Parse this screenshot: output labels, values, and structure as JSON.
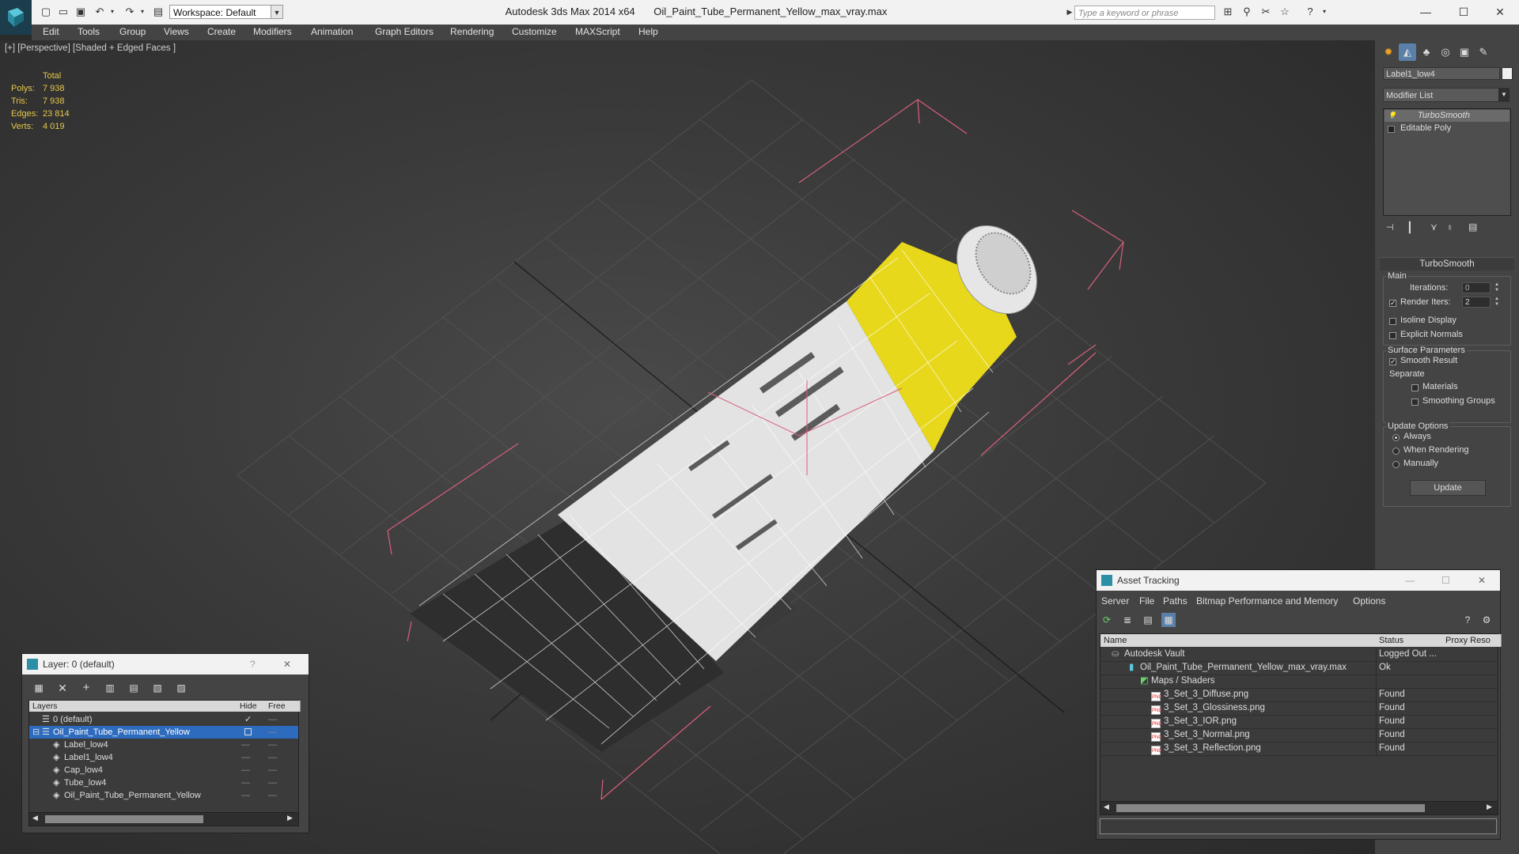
{
  "window": {
    "app_title": "Autodesk 3ds Max  2014 x64",
    "file_title": "Oil_Paint_Tube_Permanent_Yellow_max_vray.max",
    "workspace": "Workspace: Default",
    "search_placeholder": "Type a keyword or phrase"
  },
  "menu": [
    "Edit",
    "Tools",
    "Group",
    "Views",
    "Create",
    "Modifiers",
    "Animation",
    "Graph Editors",
    "Rendering",
    "Customize",
    "MAXScript",
    "Help"
  ],
  "viewport": {
    "label": "[+] [Perspective] [Shaded + Edged Faces ]",
    "stats": {
      "header": "Total",
      "rows": [
        {
          "label": "Polys:",
          "value": "7 938"
        },
        {
          "label": "Tris:",
          "value": "7 938"
        },
        {
          "label": "Edges:",
          "value": "23 814"
        },
        {
          "label": "Verts:",
          "value": "4 019"
        }
      ]
    },
    "object_colors": {
      "tube_body": "#e9e9e9",
      "tube_shoulder": "#e7d81c",
      "selection_bracket": "#d9607a",
      "grid": "#575757"
    }
  },
  "command_panel": {
    "object_name": "Label1_low4",
    "modifier_list": "Modifier List",
    "stack": [
      "TurboSmooth",
      "Editable Poly"
    ],
    "turbosmooth": {
      "title": "TurboSmooth",
      "main_group": "Main",
      "iterations_label": "Iterations:",
      "iterations_value": "0",
      "render_iters_label": "Render Iters:",
      "render_iters_value": "2",
      "render_iters_checked": true,
      "isoline_label": "Isoline Display",
      "explicit_label": "Explicit Normals",
      "surface_group": "Surface Parameters",
      "smooth_result_label": "Smooth Result",
      "separate_label": "Separate",
      "materials_label": "Materials",
      "smoothing_groups_label": "Smoothing Groups",
      "update_group": "Update Options",
      "always_label": "Always",
      "when_rendering_label": "When Rendering",
      "manually_label": "Manually",
      "update_button": "Update"
    }
  },
  "layer_dialog": {
    "title": "Layer: 0 (default)",
    "help": "?",
    "columns": [
      "Layers",
      "Hide",
      "Free"
    ],
    "rows": [
      {
        "name": "0 (default)",
        "indent": 1,
        "selected": false
      },
      {
        "name": "Oil_Paint_Tube_Permanent_Yellow",
        "indent": 1,
        "selected": true
      },
      {
        "name": "Label_low4",
        "indent": 2,
        "selected": false
      },
      {
        "name": "Label1_low4",
        "indent": 2,
        "selected": false
      },
      {
        "name": "Cap_low4",
        "indent": 2,
        "selected": false
      },
      {
        "name": "Tube_low4",
        "indent": 2,
        "selected": false
      },
      {
        "name": "Oil_Paint_Tube_Permanent_Yellow",
        "indent": 2,
        "selected": false
      }
    ]
  },
  "asset_dialog": {
    "title": "Asset Tracking",
    "menu": [
      "Server",
      "File",
      "Paths",
      "Bitmap Performance and Memory",
      "Options"
    ],
    "columns": [
      "Name",
      "Status",
      "Proxy Reso"
    ],
    "rows": [
      {
        "name": "Autodesk Vault",
        "status": "Logged Out ...",
        "indent": 1
      },
      {
        "name": "Oil_Paint_Tube_Permanent_Yellow_max_vray.max",
        "status": "Ok",
        "indent": 2
      },
      {
        "name": "Maps / Shaders",
        "status": "",
        "indent": 3
      },
      {
        "name": "3_Set_3_Diffuse.png",
        "status": "Found",
        "indent": 4
      },
      {
        "name": "3_Set_3_Glossiness.png",
        "status": "Found",
        "indent": 4
      },
      {
        "name": "3_Set_3_IOR.png",
        "status": "Found",
        "indent": 4
      },
      {
        "name": "3_Set_3_Normal.png",
        "status": "Found",
        "indent": 4
      },
      {
        "name": "3_Set_3_Reflection.png",
        "status": "Found",
        "indent": 4
      }
    ]
  }
}
